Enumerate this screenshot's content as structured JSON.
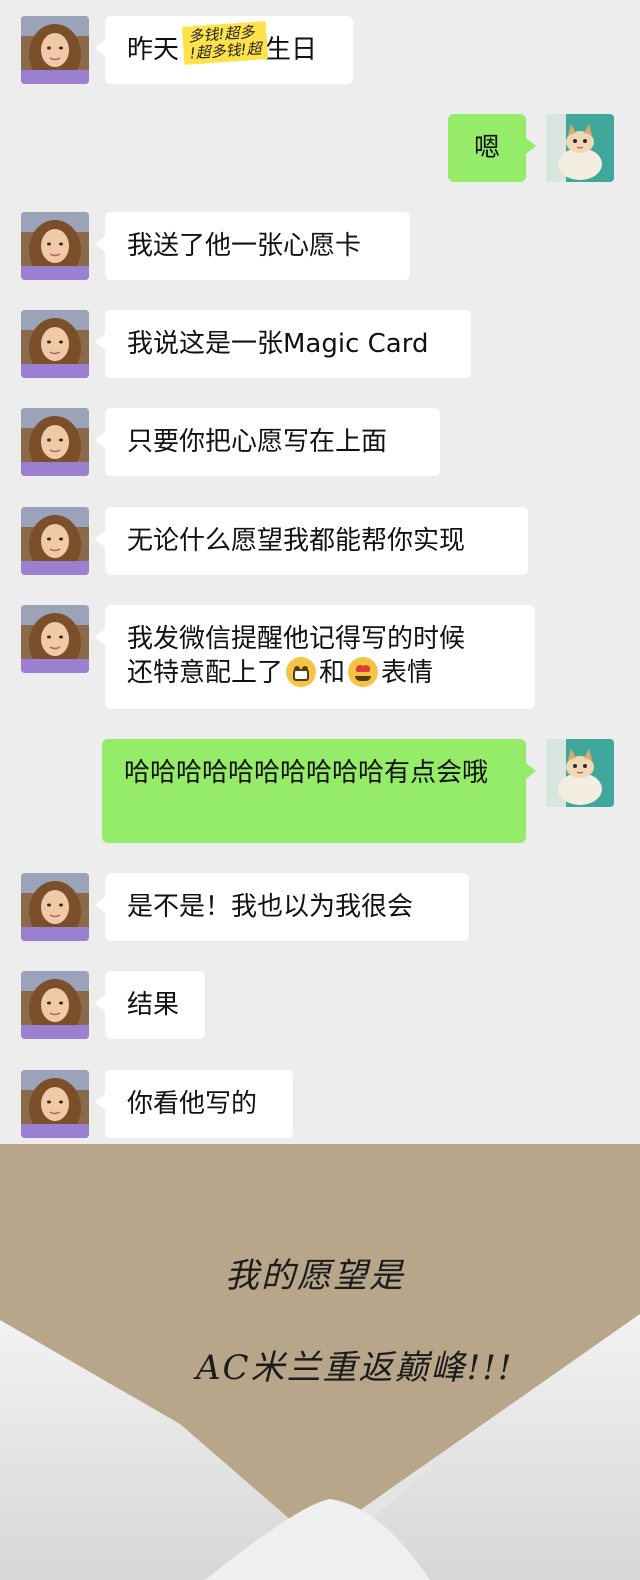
{
  "messages": [
    {
      "side": "left",
      "text": "昨天",
      "text_after": "生日",
      "sticker": [
        "多钱!超多",
        "!超多钱!超"
      ]
    },
    {
      "side": "right",
      "text": "嗯"
    },
    {
      "side": "left",
      "text": "我送了他一张心愿卡"
    },
    {
      "side": "left",
      "text": "我说这是一张Magic Card"
    },
    {
      "side": "left",
      "text": "只要你把心愿写在上面"
    },
    {
      "side": "left",
      "text": "无论什么愿望我都能帮你实现"
    },
    {
      "side": "left",
      "line1": "我发微信提醒他记得写的时候",
      "line2_a": "还特意配上了",
      "line2_b": "和",
      "line2_c": "表情",
      "emoji1": "grimacing-emoji",
      "emoji2": "heart-eyes-emoji"
    },
    {
      "side": "right",
      "text": "哈哈哈哈哈哈哈哈哈哈有点会哦"
    },
    {
      "side": "left",
      "text": "是不是！我也以为我很会"
    },
    {
      "side": "left",
      "text": "结果"
    },
    {
      "side": "left",
      "text": "你看他写的"
    }
  ],
  "card": {
    "line1": "我的愿望是",
    "line2": "AC米兰重返巅峰!!!"
  },
  "colors": {
    "background": "#ededed",
    "self_bubble": "#95ec69",
    "other_bubble": "#ffffff",
    "card": "#b5a488"
  }
}
